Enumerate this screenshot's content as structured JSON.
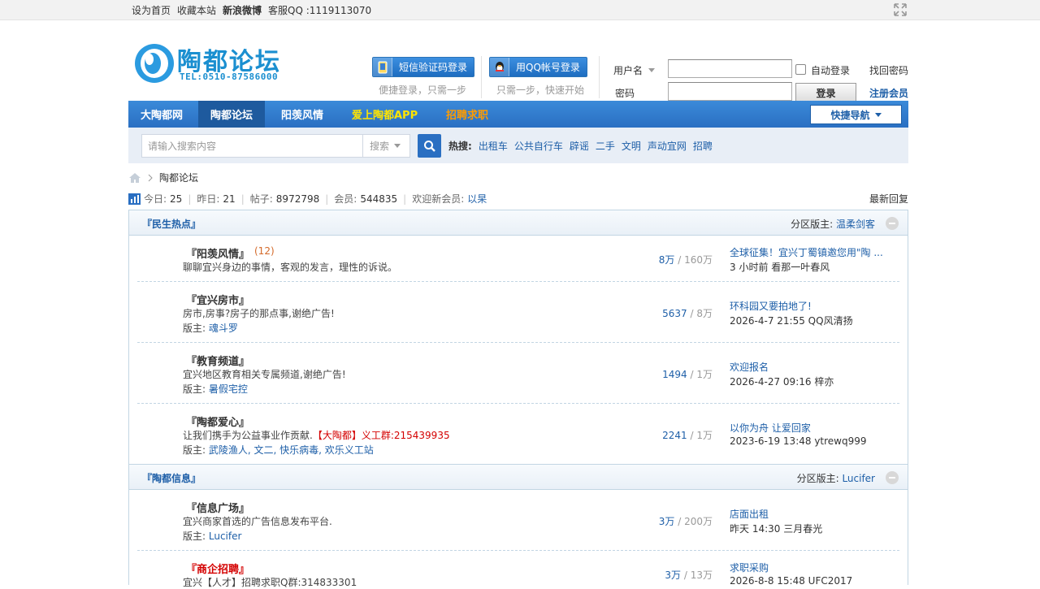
{
  "topbar": {
    "set_home": "设为首页",
    "bookmark": "收藏本站",
    "weibo": "新浪微博",
    "qq_support": "客服QQ :1119113070"
  },
  "logo": {
    "name": "陶都论坛",
    "tel": "TEL:0510-87586000"
  },
  "login": {
    "sms_button": "短信验证码登录",
    "sms_sub": "便捷登录，只需一步",
    "qq_button": "用QQ帐号登录",
    "qq_sub": "只需一步，快速开始",
    "username_label": "用户名",
    "password_label": "密码",
    "auto_login": "自动登录",
    "submit": "登录",
    "forgot": "找回密码",
    "register": "注册会员"
  },
  "nav": {
    "items": [
      "大陶都网",
      "陶都论坛",
      "阳羡风情",
      "爱上陶都APP",
      "招聘求职"
    ],
    "quick_nav": "快捷导航"
  },
  "search": {
    "placeholder": "请输入搜索内容",
    "type": "搜索",
    "hot_label": "热搜:",
    "hot_items": [
      "出租车",
      "公共自行车",
      "辟谣",
      "二手",
      "文明",
      "声动宜网",
      "招聘"
    ]
  },
  "breadcrumb": {
    "current": "陶都论坛"
  },
  "stats": {
    "today_label": "今日:",
    "today": "25",
    "yesterday_label": "昨日:",
    "yesterday": "21",
    "posts_label": "帖子:",
    "posts": "8972798",
    "members_label": "会员:",
    "members": "544835",
    "welcome_label": "欢迎新会员:",
    "new_member": "以杲",
    "latest_reply": "最新回复"
  },
  "sections": [
    {
      "title": "『民生热点』",
      "mods_label": "分区版主:",
      "mods": "温柔剑客",
      "forums": [
        {
          "name": "『阳羡风情』",
          "today": "(12)",
          "desc": "聊聊宜兴身边的事情，客观的发言，理性的诉说。",
          "mods_label": "",
          "mods": "",
          "threads": "8万",
          "posts": "160万",
          "last_title": "全球征集！宜兴丁蜀镇邀您用\"陶 ...",
          "last_meta": "3 小时前 看那一叶春风"
        },
        {
          "name": "『宜兴房市』",
          "today": "",
          "desc": "房市,房事?房子的那点事,谢绝广告!",
          "mods_label": "版主:",
          "mods": "魂斗罗",
          "threads": "5637",
          "posts": "8万",
          "last_title": "环科园又要拍地了!",
          "last_meta": "2026-4-7 21:55 QQ风清扬"
        },
        {
          "name": "『教育频道』",
          "today": "",
          "desc": "宜兴地区教育相关专属频道,谢绝广告!",
          "mods_label": "版主:",
          "mods": "暑假宅控",
          "threads": "1494",
          "posts": "1万",
          "last_title": "欢迎报名",
          "last_meta": "2026-4-27 09:16 梓亦"
        },
        {
          "name": "『陶都爱心』",
          "today": "",
          "desc": "让我们携手为公益事业作贡献.【大陶都】义工群:215439935",
          "desc_plain": "让我们携手为公益事业作贡献.",
          "desc_hl": "【大陶都】义工群:215439935",
          "mods_label": "版主:",
          "mods": "武陵渔人, 文二, 快乐病毒, 欢乐义工站",
          "threads": "2241",
          "posts": "1万",
          "last_title": "以你为舟 让爱回家",
          "last_meta": "2023-6-19 13:48 ytrewq999"
        }
      ]
    },
    {
      "title": "『陶都信息』",
      "mods_label": "分区版主:",
      "mods": "Lucifer",
      "forums": [
        {
          "name": "『信息广场』",
          "today": "",
          "desc": "宜兴商家首选的广告信息发布平台.",
          "mods_label": "版主:",
          "mods": "Lucifer",
          "threads": "3万",
          "posts": "200万",
          "last_title": "店面出租",
          "last_meta": "昨天 14:30 三月春光"
        },
        {
          "name": "『商企招聘』",
          "today": "",
          "desc": "宜兴【人才】招聘求职Q群:314833301",
          "mods_label": "",
          "mods": "",
          "threads": "3万",
          "posts": "13万",
          "last_title": "求职采购",
          "last_meta": "2026-8-8 15:48 UFC2017"
        }
      ]
    }
  ]
}
